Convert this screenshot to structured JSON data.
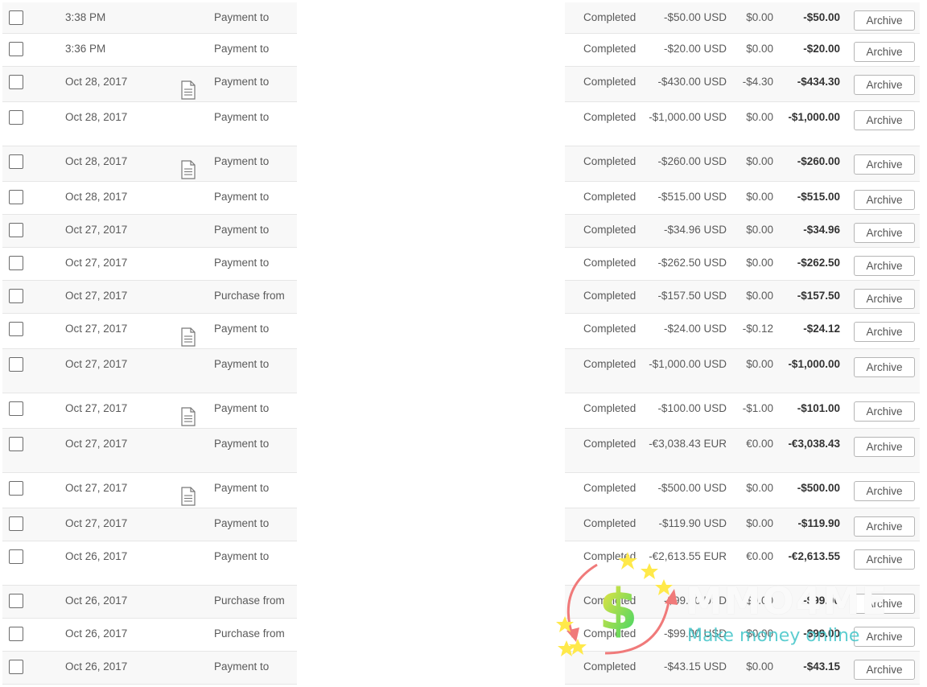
{
  "archive_label": "Archive",
  "rows": [
    {
      "date": "3:38 PM",
      "desc": "Payment to",
      "doc": false,
      "status": "Completed",
      "gross": "-$50.00 USD",
      "fee": "$0.00",
      "net": "-$50.00",
      "h": 39
    },
    {
      "date": "3:36 PM",
      "desc": "Payment to",
      "doc": false,
      "status": "Completed",
      "gross": "-$20.00 USD",
      "fee": "$0.00",
      "net": "-$20.00",
      "h": 41
    },
    {
      "date": "Oct 28, 2017",
      "desc": "Payment to",
      "doc": true,
      "status": "Completed",
      "gross": "-$430.00 USD",
      "fee": "-$4.30",
      "net": "-$434.30",
      "h": 44
    },
    {
      "date": "Oct 28, 2017",
      "desc": "Payment to",
      "doc": false,
      "status": "Completed",
      "gross": "-$1,000.00 USD",
      "fee": "$0.00",
      "net": "-$1,000.00",
      "h": 55
    },
    {
      "date": "Oct 28, 2017",
      "desc": "Payment to",
      "doc": true,
      "status": "Completed",
      "gross": "-$260.00 USD",
      "fee": "$0.00",
      "net": "-$260.00",
      "h": 44
    },
    {
      "date": "Oct 28, 2017",
      "desc": "Payment to",
      "doc": false,
      "status": "Completed",
      "gross": "-$515.00 USD",
      "fee": "$0.00",
      "net": "-$515.00",
      "h": 41
    },
    {
      "date": "Oct 27, 2017",
      "desc": "Payment to",
      "doc": false,
      "status": "Completed",
      "gross": "-$34.96 USD",
      "fee": "$0.00",
      "net": "-$34.96",
      "h": 41
    },
    {
      "date": "Oct 27, 2017",
      "desc": "Payment to",
      "doc": false,
      "status": "Completed",
      "gross": "-$262.50 USD",
      "fee": "$0.00",
      "net": "-$262.50",
      "h": 41
    },
    {
      "date": "Oct 27, 2017",
      "desc": "Purchase from",
      "doc": false,
      "status": "Completed",
      "gross": "-$157.50 USD",
      "fee": "$0.00",
      "net": "-$157.50",
      "h": 41
    },
    {
      "date": "Oct 27, 2017",
      "desc": "Payment to",
      "doc": true,
      "status": "Completed",
      "gross": "-$24.00 USD",
      "fee": "-$0.12",
      "net": "-$24.12",
      "h": 44
    },
    {
      "date": "Oct 27, 2017",
      "desc": "Payment to",
      "doc": false,
      "status": "Completed",
      "gross": "-$1,000.00 USD",
      "fee": "$0.00",
      "net": "-$1,000.00",
      "h": 55
    },
    {
      "date": "Oct 27, 2017",
      "desc": "Payment to",
      "doc": true,
      "status": "Completed",
      "gross": "-$100.00 USD",
      "fee": "-$1.00",
      "net": "-$101.00",
      "h": 44
    },
    {
      "date": "Oct 27, 2017",
      "desc": "Payment to",
      "doc": false,
      "status": "Completed",
      "gross": "-€3,038.43 EUR",
      "fee": "€0.00",
      "net": "-€3,038.43",
      "h": 55
    },
    {
      "date": "Oct 27, 2017",
      "desc": "Payment to",
      "doc": true,
      "status": "Completed",
      "gross": "-$500.00 USD",
      "fee": "$0.00",
      "net": "-$500.00",
      "h": 44
    },
    {
      "date": "Oct 27, 2017",
      "desc": "Payment to",
      "doc": false,
      "status": "Completed",
      "gross": "-$119.90 USD",
      "fee": "$0.00",
      "net": "-$119.90",
      "h": 41
    },
    {
      "date": "Oct 26, 2017",
      "desc": "Payment to",
      "doc": false,
      "status": "Completed",
      "gross": "-€2,613.55 EUR",
      "fee": "€0.00",
      "net": "-€2,613.55",
      "h": 55
    },
    {
      "date": "Oct 26, 2017",
      "desc": "Purchase from",
      "doc": false,
      "status": "Completed",
      "gross": "-$99.00 USD",
      "fee": "$0.00",
      "net": "-$99.00",
      "h": 41
    },
    {
      "date": "Oct 26, 2017",
      "desc": "Purchase from",
      "doc": false,
      "status": "Completed",
      "gross": "-$99.00 USD",
      "fee": "$0.00",
      "net": "-$99.00",
      "h": 41
    },
    {
      "date": "Oct 26, 2017",
      "desc": "Payment to",
      "doc": false,
      "status": "Completed",
      "gross": "-$43.15 USD",
      "fee": "$0.00",
      "net": "-$43.15",
      "h": 41
    }
  ],
  "watermark": {
    "brand": "MMO4ME",
    "tagline": "Make money online"
  }
}
